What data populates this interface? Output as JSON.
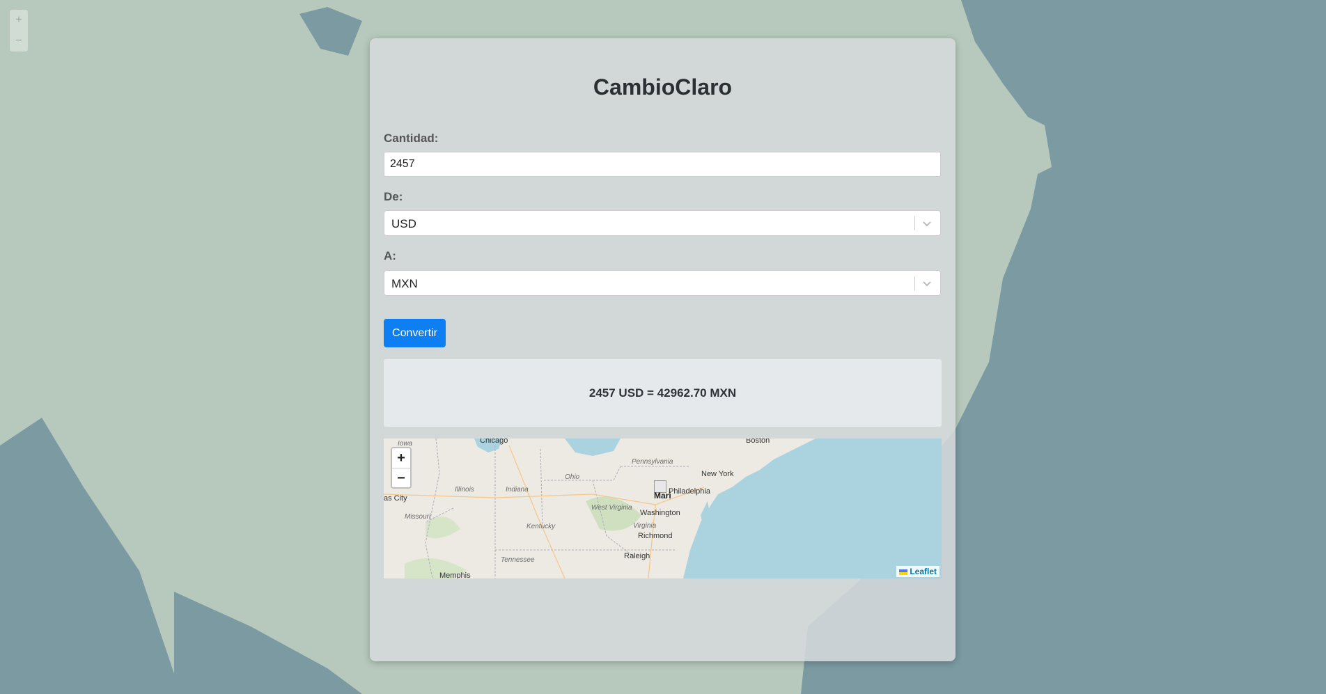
{
  "app": {
    "title": "CambioClaro"
  },
  "form": {
    "amount_label": "Cantidad:",
    "amount_value": "2457",
    "from_label": "De:",
    "from_value": "USD",
    "to_label": "A:",
    "to_value": "MXN",
    "convert_label": "Convertir"
  },
  "result": {
    "text": "2457 USD = 42962.70 MXN"
  },
  "map": {
    "zoom_in": "+",
    "zoom_out": "−",
    "attribution": "Leaflet",
    "marker_label": "Mari",
    "cities": [
      "Chicago",
      "Boston",
      "New York",
      "Philadelphia",
      "Washington",
      "Richmond",
      "Raleigh",
      "Memphis",
      "as City"
    ],
    "states": [
      "Iowa",
      "Illinois",
      "Indiana",
      "Ohio",
      "Pennsylvania",
      "West Virginia",
      "Virginia",
      "Kentucky",
      "Missouri",
      "Tennessee"
    ]
  },
  "colors": {
    "accent": "#0d7ff2",
    "water": "#aad3df",
    "land": "#eceae3"
  }
}
